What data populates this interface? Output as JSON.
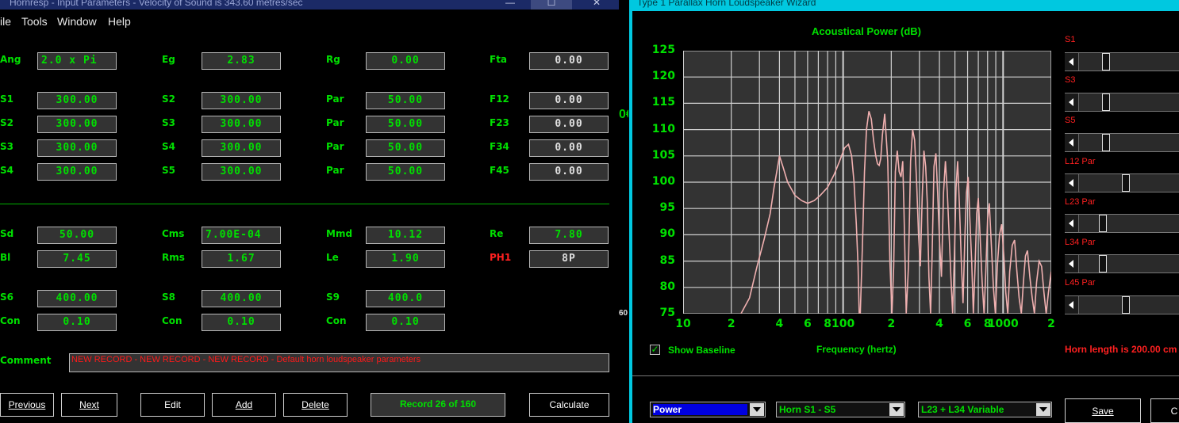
{
  "left_window": {
    "title": "Hornresp - Input Parameters - Velocity of Sound is 343.60 metres/sec",
    "menu": [
      "ile",
      "Tools",
      "Window",
      "Help"
    ],
    "fields": [
      {
        "label": "Ang",
        "value": "2.0 x Pi"
      },
      {
        "label": "Eg",
        "value": "2.83"
      },
      {
        "label": "Rg",
        "value": "0.00"
      },
      {
        "label": "Fta",
        "value": "0.00"
      },
      {
        "label": "S1",
        "value": "300.00"
      },
      {
        "label": "S2",
        "value": "300.00"
      },
      {
        "label": "Par",
        "value": "50.00"
      },
      {
        "label": "F12",
        "value": "0.00"
      },
      {
        "label": "S2",
        "value": "300.00"
      },
      {
        "label": "S3",
        "value": "300.00"
      },
      {
        "label": "Par",
        "value": "50.00"
      },
      {
        "label": "F23",
        "value": "0.00"
      },
      {
        "label": "S3",
        "value": "300.00"
      },
      {
        "label": "S4",
        "value": "300.00"
      },
      {
        "label": "Par",
        "value": "50.00"
      },
      {
        "label": "F34",
        "value": "0.00"
      },
      {
        "label": "S4",
        "value": "300.00"
      },
      {
        "label": "S5",
        "value": "300.00"
      },
      {
        "label": "Par",
        "value": "50.00"
      },
      {
        "label": "F45",
        "value": "0.00"
      },
      {
        "label": "Sd",
        "value": "50.00"
      },
      {
        "label": "Cms",
        "value": "7.00E-04"
      },
      {
        "label": "Mmd",
        "value": "10.12"
      },
      {
        "label": "Re",
        "value": "7.80"
      },
      {
        "label": "Bl",
        "value": "7.45"
      },
      {
        "label": "Rms",
        "value": "1.67"
      },
      {
        "label": "Le",
        "value": "1.90"
      },
      {
        "label": "PH1",
        "value": "8P"
      },
      {
        "label": "S6",
        "value": "400.00"
      },
      {
        "label": "S8",
        "value": "400.00"
      },
      {
        "label": "S9",
        "value": "400.0"
      },
      {
        "label": "Con",
        "value": "0.10"
      },
      {
        "label": "Con",
        "value": "0.10"
      },
      {
        "label": "Con",
        "value": "0.10"
      }
    ],
    "comment_label": "Comment",
    "comment": "NEW RECORD - NEW RECORD - NEW RECORD - Default horn loudspeaker parameters",
    "buttons": {
      "previous": "Previous",
      "next": "Next",
      "edit": "Edit",
      "add": "Add",
      "delete": "Delete",
      "calculate": "Calculate"
    },
    "record": "Record 26 of 160",
    "edge_fragments": [
      "0€",
      "60"
    ]
  },
  "right_window": {
    "title": "Type 1 Parallax Horn Loudspeaker Wizard",
    "show_baseline_label": "Show Baseline",
    "show_baseline_checked": true,
    "frequency_label": "Frequency (hertz)",
    "horn_length": "Horn length is 200.00 cm",
    "sliders": [
      {
        "label": "S1",
        "value": 0.38
      },
      {
        "label": "S3",
        "value": 0.38
      },
      {
        "label": "S5",
        "value": 0.38
      },
      {
        "label": "L12  Par",
        "value": 0.71
      },
      {
        "label": "L23  Par",
        "value": 0.33
      },
      {
        "label": "L34  Par",
        "value": 0.33
      },
      {
        "label": "L45  Par",
        "value": 0.71
      }
    ],
    "dropdowns": {
      "mode": "Power",
      "horn": "Horn S1 - S5",
      "variable": "L23 + L34 Variable"
    },
    "buttons": {
      "save": "Save",
      "cancel": "C"
    }
  },
  "chart_data": {
    "type": "line",
    "title": "Acoustical Power (dB)",
    "xlabel": "Frequency (hertz)",
    "ylabel": "",
    "x_scale": "log",
    "xlim": [
      10,
      2000
    ],
    "ylim": [
      75,
      125
    ],
    "grid": true,
    "x_tick_labels": [
      "10",
      "2",
      "4",
      "6",
      "8",
      "100",
      "2",
      "4",
      "6",
      "8",
      "1000",
      "2"
    ],
    "y_ticks": [
      125,
      120,
      115,
      110,
      105,
      100,
      95,
      90,
      85,
      80,
      75
    ],
    "colors": {
      "line": "#f0b0b0",
      "plot_bg": "#333333",
      "grid": "#d0d0d0",
      "text": "#00e000"
    },
    "series": [
      {
        "x": [
          23,
          26,
          29,
          32,
          35,
          37,
          39,
          40,
          42,
          45,
          50,
          55,
          60,
          66,
          72,
          80,
          88,
          95,
          102,
          108,
          113,
          117,
          121,
          124,
          126,
          128,
          132,
          136,
          140,
          145,
          150,
          155,
          160,
          164,
          168,
          172,
          176,
          182,
          190,
          196,
          202,
          207,
          212,
          218,
          224,
          230,
          236,
          240,
          248,
          256,
          264,
          272,
          280,
          288,
          296,
          304,
          312,
          320,
          328,
          336,
          344,
          352,
          360,
          370,
          380,
          390,
          400,
          412,
          424,
          436,
          448,
          460,
          472,
          484,
          496,
          508,
          520,
          534,
          548,
          562,
          576,
          590,
          605,
          620,
          636,
          652,
          668,
          684,
          700,
          720,
          740,
          760,
          780,
          800,
          820,
          845,
          870,
          895,
          920,
          950,
          980,
          1010,
          1040,
          1070,
          1100,
          1140,
          1180,
          1220,
          1260,
          1300,
          1340,
          1380,
          1420,
          1470,
          1520,
          1570,
          1620,
          1680,
          1740,
          1800,
          1860,
          1920,
          2000
        ],
        "y": [
          75,
          78,
          84,
          89,
          94,
          99,
          103,
          105,
          103,
          100,
          97.5,
          96.5,
          96,
          96.5,
          97.5,
          99,
          101.5,
          104,
          106.5,
          107.2,
          105,
          100,
          92,
          84,
          75,
          75,
          88,
          102,
          110,
          113.5,
          112,
          108,
          105,
          103.5,
          103.2,
          104.5,
          109,
          113,
          104,
          85,
          75,
          84,
          102,
          106,
          102,
          101,
          104,
          95,
          75,
          84,
          104,
          110,
          108,
          100,
          90,
          84,
          97,
          106,
          103,
          96,
          82,
          75,
          86,
          103,
          105.5,
          98,
          89,
          82,
          98,
          104,
          98,
          90,
          82,
          75,
          86,
          99,
          104,
          95,
          85,
          77,
          89,
          98,
          101,
          93,
          85,
          75,
          84,
          94,
          97,
          89,
          81,
          75,
          83,
          93,
          96,
          88,
          80,
          75,
          84,
          90,
          92,
          86,
          79,
          75,
          83,
          88,
          89,
          83,
          78,
          75,
          81,
          86,
          87,
          82,
          78,
          75,
          81,
          85,
          84,
          79,
          75,
          79,
          83
        ]
      }
    ]
  }
}
